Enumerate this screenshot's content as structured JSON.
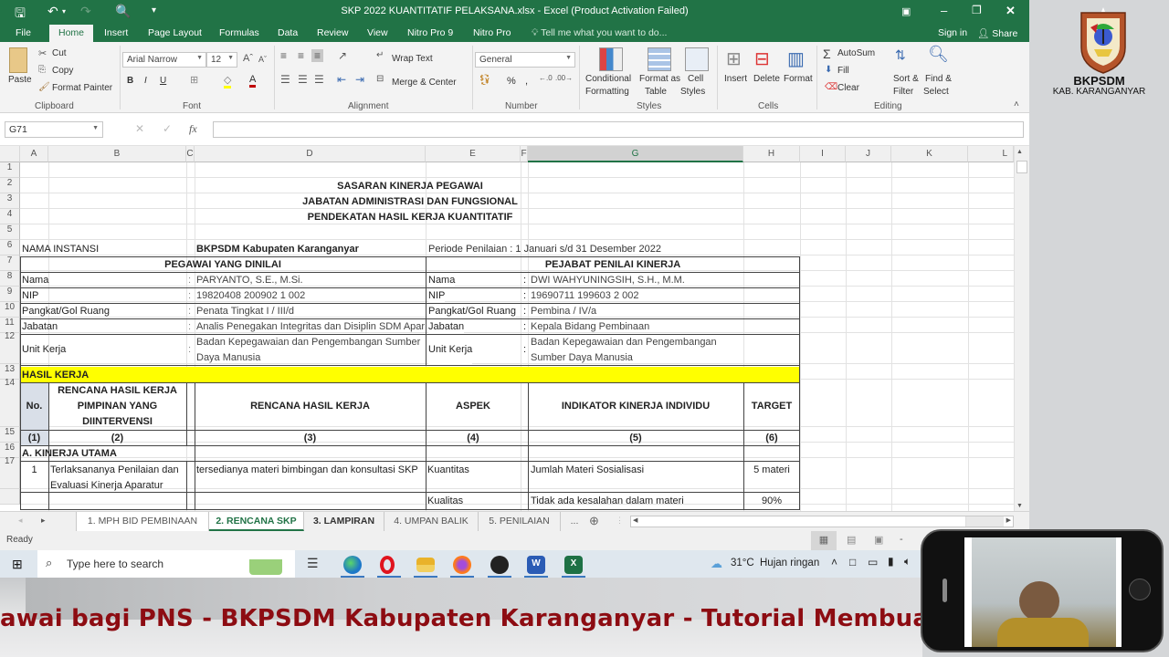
{
  "window": {
    "title": "SKP 2022 KUANTITATIF PELAKSANA.xlsx - Excel (Product Activation Failed)",
    "controls": [
      "ribbon-display",
      "minimize",
      "restore",
      "close"
    ]
  },
  "ribbon_tabs": [
    "File",
    "Home",
    "Insert",
    "Page Layout",
    "Formulas",
    "Data",
    "Review",
    "View",
    "Nitro Pro 9",
    "Nitro Pro"
  ],
  "active_tab": "Home",
  "tell_me": "Tell me what you want to do...",
  "sign_in": "Sign in",
  "share": "Share",
  "ribbon": {
    "clipboard": {
      "paste": "Paste",
      "cut": "Cut",
      "copy": "Copy",
      "format_painter": "Format Painter",
      "label": "Clipboard"
    },
    "font": {
      "name": "Arial Narrow",
      "size": "12",
      "bold": "B",
      "italic": "I",
      "underline": "U",
      "label": "Font"
    },
    "alignment": {
      "wrap_text": "Wrap Text",
      "merge_center": "Merge & Center",
      "label": "Alignment"
    },
    "number": {
      "format": "General",
      "percent": "%",
      "comma": ",",
      "label": "Number"
    },
    "styles": {
      "conditional": "Conditional",
      "conditional2": "Formatting",
      "format_table": "Format as",
      "format_table2": "Table",
      "cell_styles": "Cell",
      "cell_styles2": "Styles",
      "label": "Styles"
    },
    "cells": {
      "insert": "Insert",
      "delete": "Delete",
      "format": "Format",
      "label": "Cells"
    },
    "editing": {
      "autosum": "AutoSum",
      "fill": "Fill",
      "clear": "Clear",
      "sort": "Sort &",
      "sort2": "Filter",
      "find": "Find &",
      "find2": "Select",
      "label": "Editing"
    }
  },
  "formula_bar": {
    "name_box": "G71",
    "fx": "fx",
    "value": ""
  },
  "columns": [
    "A",
    "B",
    "C",
    "D",
    "E",
    "F",
    "G",
    "H",
    "I",
    "J",
    "K",
    "L"
  ],
  "selected_column": "G",
  "rows": [
    "1",
    "2",
    "3",
    "4",
    "5",
    "6",
    "7",
    "8",
    "9",
    "10",
    "11",
    "12",
    "13",
    "14",
    "15",
    "16",
    "17",
    ""
  ],
  "sheet": {
    "title1": "SASARAN KINERJA PEGAWAI",
    "title2": "JABATAN ADMINISTRASI DAN FUNGSIONAL",
    "title3": "PENDEKATAN HASIL KERJA KUANTITATIF",
    "instansi_label": "NAMA INSTANSI",
    "instansi_value": "BKPSDM Kabupaten Karanganyar",
    "periode": "Periode Penilaian : 1 Januari s/d 31 Desember 2022",
    "pegawai_header": "PEGAWAI YANG DINILAI",
    "pejabat_header": "PEJABAT PENILAI KINERJA",
    "colon": ":",
    "pegawai": [
      {
        "label": "Nama",
        "value": "PARYANTO, S.E., M.Si."
      },
      {
        "label": "NIP",
        "value": "19820408 200902 1 002"
      },
      {
        "label": "Pangkat/Gol Ruang",
        "value": "Penata Tingkat I / III/d"
      },
      {
        "label": "Jabatan",
        "value": "Analis Penegakan Integritas dan Disiplin SDM Apar"
      },
      {
        "label": "Unit Kerja",
        "value": "Badan Kepegawaian dan Pengembangan Sumber",
        "value2": "Daya Manusia"
      }
    ],
    "pejabat": [
      {
        "label": "Nama",
        "value": "DWI WAHYUNINGSIH, S.H., M.M."
      },
      {
        "label": "NIP",
        "value": "19690711 199603 2 002"
      },
      {
        "label": "Pangkat/Gol Ruang",
        "value": "Pembina / IV/a"
      },
      {
        "label": "Jabatan",
        "value": "Kepala Bidang Pembinaan"
      },
      {
        "label": "Unit Kerja",
        "value": "Badan Kepegawaian dan Pengembangan",
        "value2": "Sumber Daya Manusia"
      }
    ],
    "hasil_kerja": "HASIL KERJA",
    "table_headers": {
      "no": "No.",
      "rhk_pimpinan_1": "RENCANA HASIL KERJA",
      "rhk_pimpinan_2": "PIMPINAN YANG",
      "rhk_pimpinan_3": "DIINTERVENSI",
      "rhk": "RENCANA HASIL KERJA",
      "aspek": "ASPEK",
      "indikator": "INDIKATOR KINERJA INDIVIDU",
      "target": "TARGET"
    },
    "col_numbers": [
      "(1)",
      "(2)",
      "(3)",
      "(4)",
      "(5)",
      "(6)"
    ],
    "section_a": "A. KINERJA UTAMA",
    "items": [
      {
        "no": "1",
        "rhk_pimpinan_1": "Terlaksananya Penilaian dan",
        "rhk_pimpinan_2": "Evaluasi Kinerja Aparatur",
        "rhk": "tersedianya materi bimbingan dan konsultasi SKP",
        "indicators": [
          {
            "aspek": "Kuantitas",
            "indikator": "Jumlah Materi Sosialisasi",
            "target": "5 materi"
          },
          {
            "aspek": "Kualitas",
            "indikator": "Tidak ada kesalahan dalam materi",
            "target": "90%"
          }
        ]
      }
    ]
  },
  "sheet_tabs": [
    "1. MPH BID PEMBINAAN",
    "2. RENCANA SKP",
    "3. LAMPIRAN",
    "4. UMPAN BALIK",
    "5. PENILAIAN",
    "..."
  ],
  "active_sheet": "2. RENCANA SKP",
  "status": "Ready",
  "taskbar": {
    "search_placeholder": "Type here to search",
    "apps": [
      "task-view",
      "edge",
      "opera",
      "file-explorer",
      "firefox",
      "obs",
      "word",
      "excel"
    ],
    "weather": "31°C",
    "weather_desc": "Hujan ringan"
  },
  "logo": {
    "name": "BKPSDM",
    "subtitle": "KAB. KARANGANYAR"
  },
  "banner_text": "awai bagi PNS - BKPSDM Kabupaten Karanganyar - Tutorial Membuat Sasaran K",
  "colors": {
    "excel_green": "#217346",
    "highlight_yellow": "#ffff00",
    "banner_red": "#8d0c12"
  }
}
